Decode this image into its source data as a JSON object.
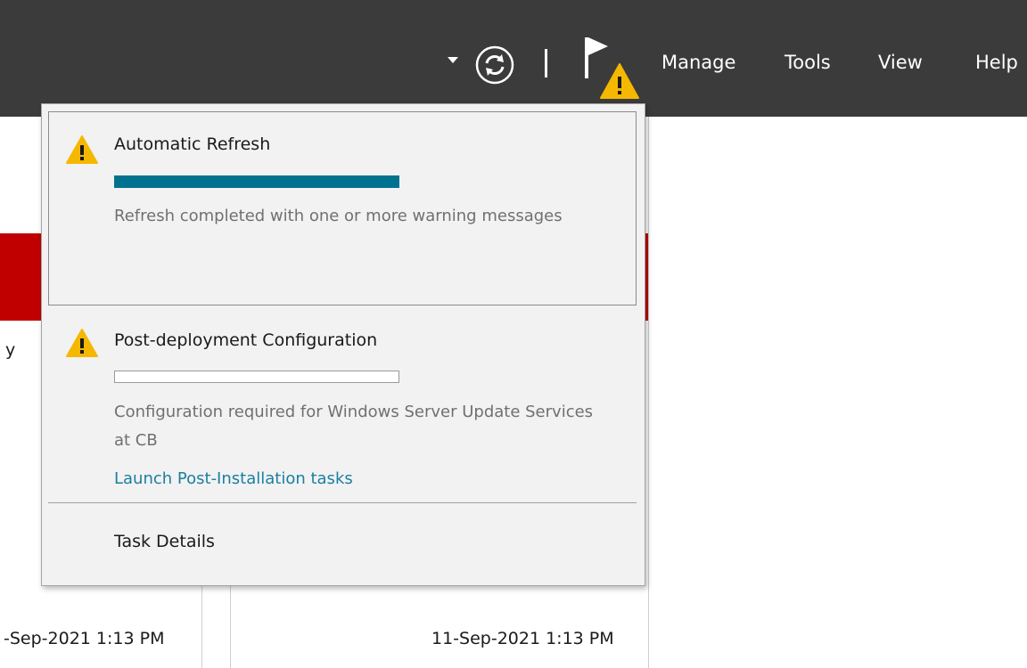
{
  "menubar": {
    "items": [
      "Manage",
      "Tools",
      "View",
      "Help"
    ]
  },
  "background": {
    "truncated_label": "y",
    "timestamps": [
      "-Sep-2021 1:13 PM",
      "11-Sep-2021 1:13 PM"
    ]
  },
  "notifications": {
    "items": [
      {
        "title": "Automatic Refresh",
        "progress": 1.0,
        "message": "Refresh completed with one or more warning messages",
        "icon": "warning-icon"
      },
      {
        "title": "Post-deployment Configuration",
        "progress": 0.0,
        "message": "Configuration required for Windows Server Update Services at CB",
        "link": "Launch Post-Installation tasks",
        "icon": "warning-icon"
      }
    ],
    "footer": "Task Details"
  },
  "colors": {
    "titlebar": "#3b3b3b",
    "progress": "#00728f",
    "link": "#1a7fa0",
    "warning": "#f5b800",
    "alert_strip": "#c00000"
  }
}
